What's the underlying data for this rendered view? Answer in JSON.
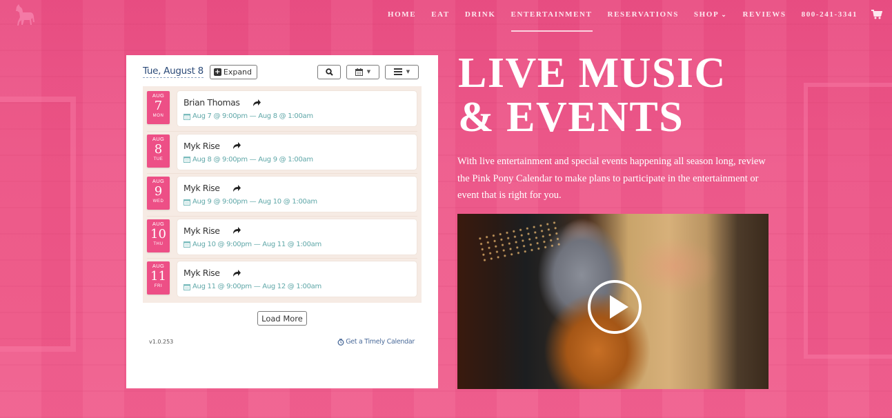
{
  "nav": {
    "items": [
      {
        "label": "HOME",
        "active": false
      },
      {
        "label": "EAT",
        "active": false
      },
      {
        "label": "DRINK",
        "active": false
      },
      {
        "label": "ENTERTAINMENT",
        "active": true
      },
      {
        "label": "RESERVATIONS",
        "active": false
      },
      {
        "label": "SHOP",
        "active": false,
        "has_dropdown": true
      },
      {
        "label": "REVIEWS",
        "active": false
      }
    ],
    "phone": "800-241-3341",
    "cart_icon": "shopping-cart-icon",
    "logo_icon": "pink-pony-horse-logo"
  },
  "calendar": {
    "current_date": "Tue, August 8",
    "expand_label": "Expand",
    "search_icon": "search-icon",
    "calendar_view_icon": "calendar-icon",
    "list_view_icon": "list-icon",
    "events": [
      {
        "month": "AUG",
        "day": "7",
        "weekday": "MON",
        "title": "Brian Thomas",
        "time": "Aug 7 @ 9:00pm — Aug 8 @ 1:00am"
      },
      {
        "month": "AUG",
        "day": "8",
        "weekday": "TUE",
        "title": "Myk Rise",
        "time": "Aug 8 @ 9:00pm — Aug 9 @ 1:00am"
      },
      {
        "month": "AUG",
        "day": "9",
        "weekday": "WED",
        "title": "Myk Rise",
        "time": "Aug 9 @ 9:00pm — Aug 10 @ 1:00am"
      },
      {
        "month": "AUG",
        "day": "10",
        "weekday": "THU",
        "title": "Myk Rise",
        "time": "Aug 10 @ 9:00pm — Aug 11 @ 1:00am"
      },
      {
        "month": "AUG",
        "day": "11",
        "weekday": "FRI",
        "title": "Myk Rise",
        "time": "Aug 11 @ 9:00pm — Aug 12 @ 1:00am"
      }
    ],
    "load_more_label": "Load More",
    "version": "v1.0.253",
    "timely_link": "Get a Timely Calendar"
  },
  "hero": {
    "title_line1": "LIVE MUSIC",
    "title_line2": "& EVENTS",
    "description": "With live entertainment and special events happening all season long, review the Pink Pony Calendar to make plans to participate in the entertainment or event that is right for you.",
    "video_play_icon": "play-icon"
  },
  "colors": {
    "brand_pink": "#ec5a8a",
    "badge_pink": "#ed4f86",
    "date_link_blue": "#2b4a78",
    "time_teal": "#5fa7a8"
  }
}
